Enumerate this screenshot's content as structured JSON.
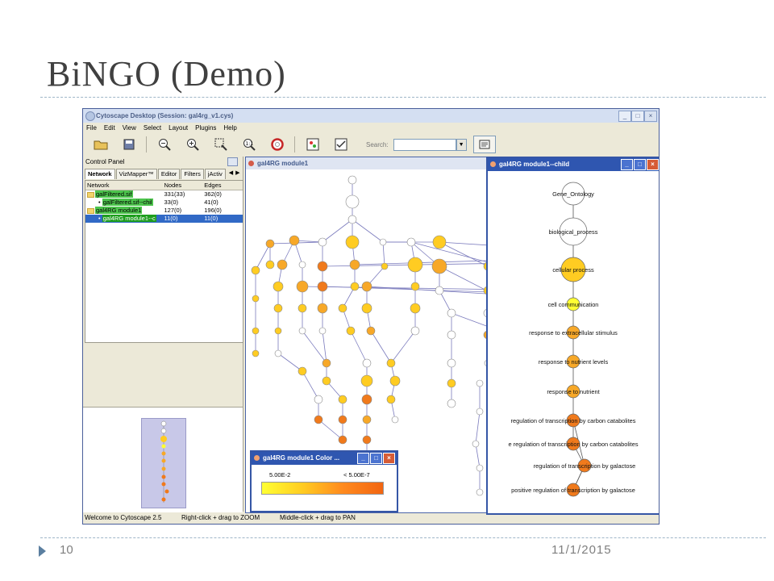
{
  "slide": {
    "title": "BiNGO (Demo)",
    "page_number": "10",
    "date": "11/1/2015"
  },
  "window": {
    "title": "Cytoscape Desktop (Session: gal4rg_v1.cys)",
    "controls": [
      "_",
      "□",
      "×"
    ]
  },
  "menu": [
    "File",
    "Edit",
    "View",
    "Select",
    "Layout",
    "Plugins",
    "Help"
  ],
  "toolbar": {
    "icons": [
      "open-folder-icon",
      "save-icon",
      "zoom-out-icon",
      "zoom-in-icon",
      "zoom-selected-icon",
      "zoom-fit-icon",
      "lifebuoy-icon",
      "node-attr-icon",
      "edge-attr-icon",
      "network-icon"
    ],
    "search_label": "Search:",
    "search_value": ""
  },
  "control_panel": {
    "title": "Control Panel",
    "tabs": [
      "Network",
      "VizMapper™",
      "Editor",
      "Filters",
      "jActiv"
    ],
    "columns": [
      "Network",
      "Nodes",
      "Edges"
    ],
    "rows": [
      {
        "name": "galFiltered.sif",
        "nodes": "331(33)",
        "edges": "362(0)"
      },
      {
        "name": "galFiltered.sif--chil",
        "nodes": "33(0)",
        "edges": "41(0)"
      },
      {
        "name": "gal4RG module1",
        "nodes": "127(0)",
        "edges": "196(0)"
      },
      {
        "name": "gal4RG module1--c",
        "nodes": "11(0)",
        "edges": "11(0)"
      }
    ]
  },
  "network_frame": {
    "title": "gal4RG module1"
  },
  "child_frame": {
    "title": "gal4RG module1--child",
    "nodes": [
      {
        "label": "Gene_Ontology",
        "color": "#ffffff"
      },
      {
        "label": "biological_process",
        "color": "#ffffff"
      },
      {
        "label": "cellular process",
        "color": "#ffcc22"
      },
      {
        "label": "cell communication",
        "color": "#ffff33"
      },
      {
        "label": "response to extracellular stimulus",
        "color": "#f7a828"
      },
      {
        "label": "response to nutrient levels",
        "color": "#f7a828"
      },
      {
        "label": "response to nutrient",
        "color": "#f7a828"
      },
      {
        "label": "regulation of transcription by carbon catabolites",
        "color": "#f07a1c"
      },
      {
        "label": "e regulation of transcription by carbon catabolites",
        "color": "#f07a1c"
      },
      {
        "label": "regulation of transcription by galactose",
        "color": "#f07a1c"
      },
      {
        "label": "positive regulation of transcription by galactose",
        "color": "#f07a1c"
      }
    ]
  },
  "legend": {
    "title": "gal4RG module1 Color ...",
    "low_label": "5.00E-2",
    "high_label": "< 5.00E-7"
  },
  "status_bar": {
    "left": "Welcome to Cytoscape 2.5",
    "mid": "Right-click + drag  to  ZOOM",
    "right": "Middle-click + drag  to  PAN"
  }
}
